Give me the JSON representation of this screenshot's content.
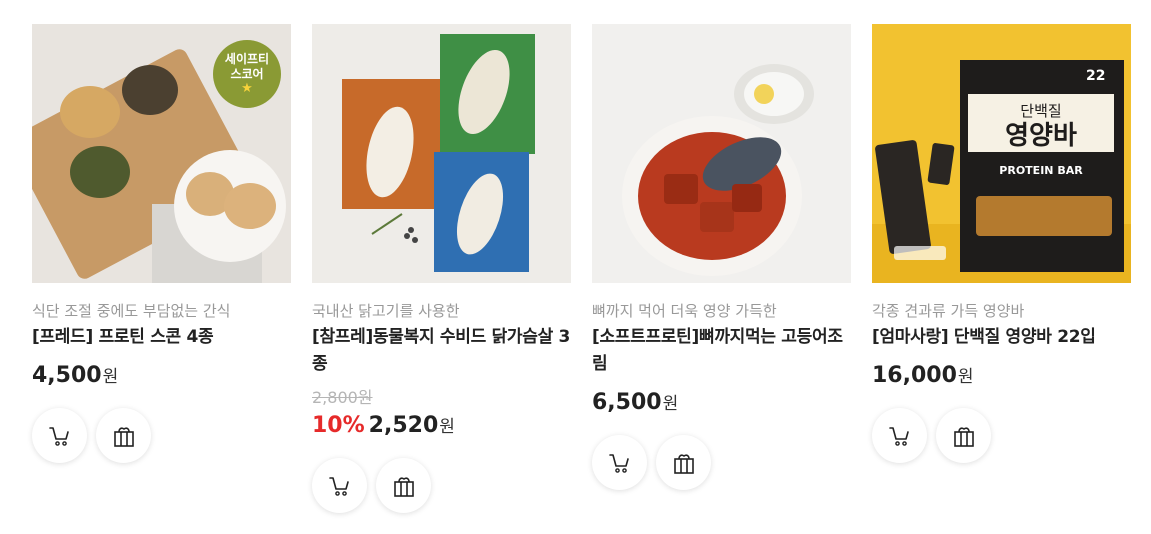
{
  "products": [
    {
      "badge": {
        "line1": "세이프티",
        "line2": "스코어",
        "star": "★"
      },
      "subtitle": "식단 조절 중에도 부담없는 간식",
      "name": "[프레드] 프로틴 스콘 4종",
      "price": "4,500",
      "unit": "원"
    },
    {
      "subtitle": "국내산 닭고기를 사용한",
      "name": "[참프레]동물복지 수비드 닭가슴살 3종",
      "original_price": "2,800원",
      "discount": "10%",
      "price": "2,520",
      "unit": "원"
    },
    {
      "subtitle": "뼈까지 먹어 더욱 영양 가득한",
      "name": "[소프트프로틴]뼈까지먹는 고등어조림",
      "price": "6,500",
      "unit": "원"
    },
    {
      "subtitle": "각종 견과류 가득 영양바",
      "name": "[엄마사랑] 단백질 영양바 22입",
      "price": "16,000",
      "unit": "원",
      "package_text": {
        "count": "22",
        "title_small": "단백질",
        "title_big": "영양바",
        "english": "PROTEIN BAR"
      }
    }
  ],
  "icons": {
    "cart": "cart-icon",
    "gift": "gift-icon"
  },
  "colors": {
    "discount": "#e62a2a",
    "badge": "#8a9a34",
    "muted": "#999999"
  }
}
